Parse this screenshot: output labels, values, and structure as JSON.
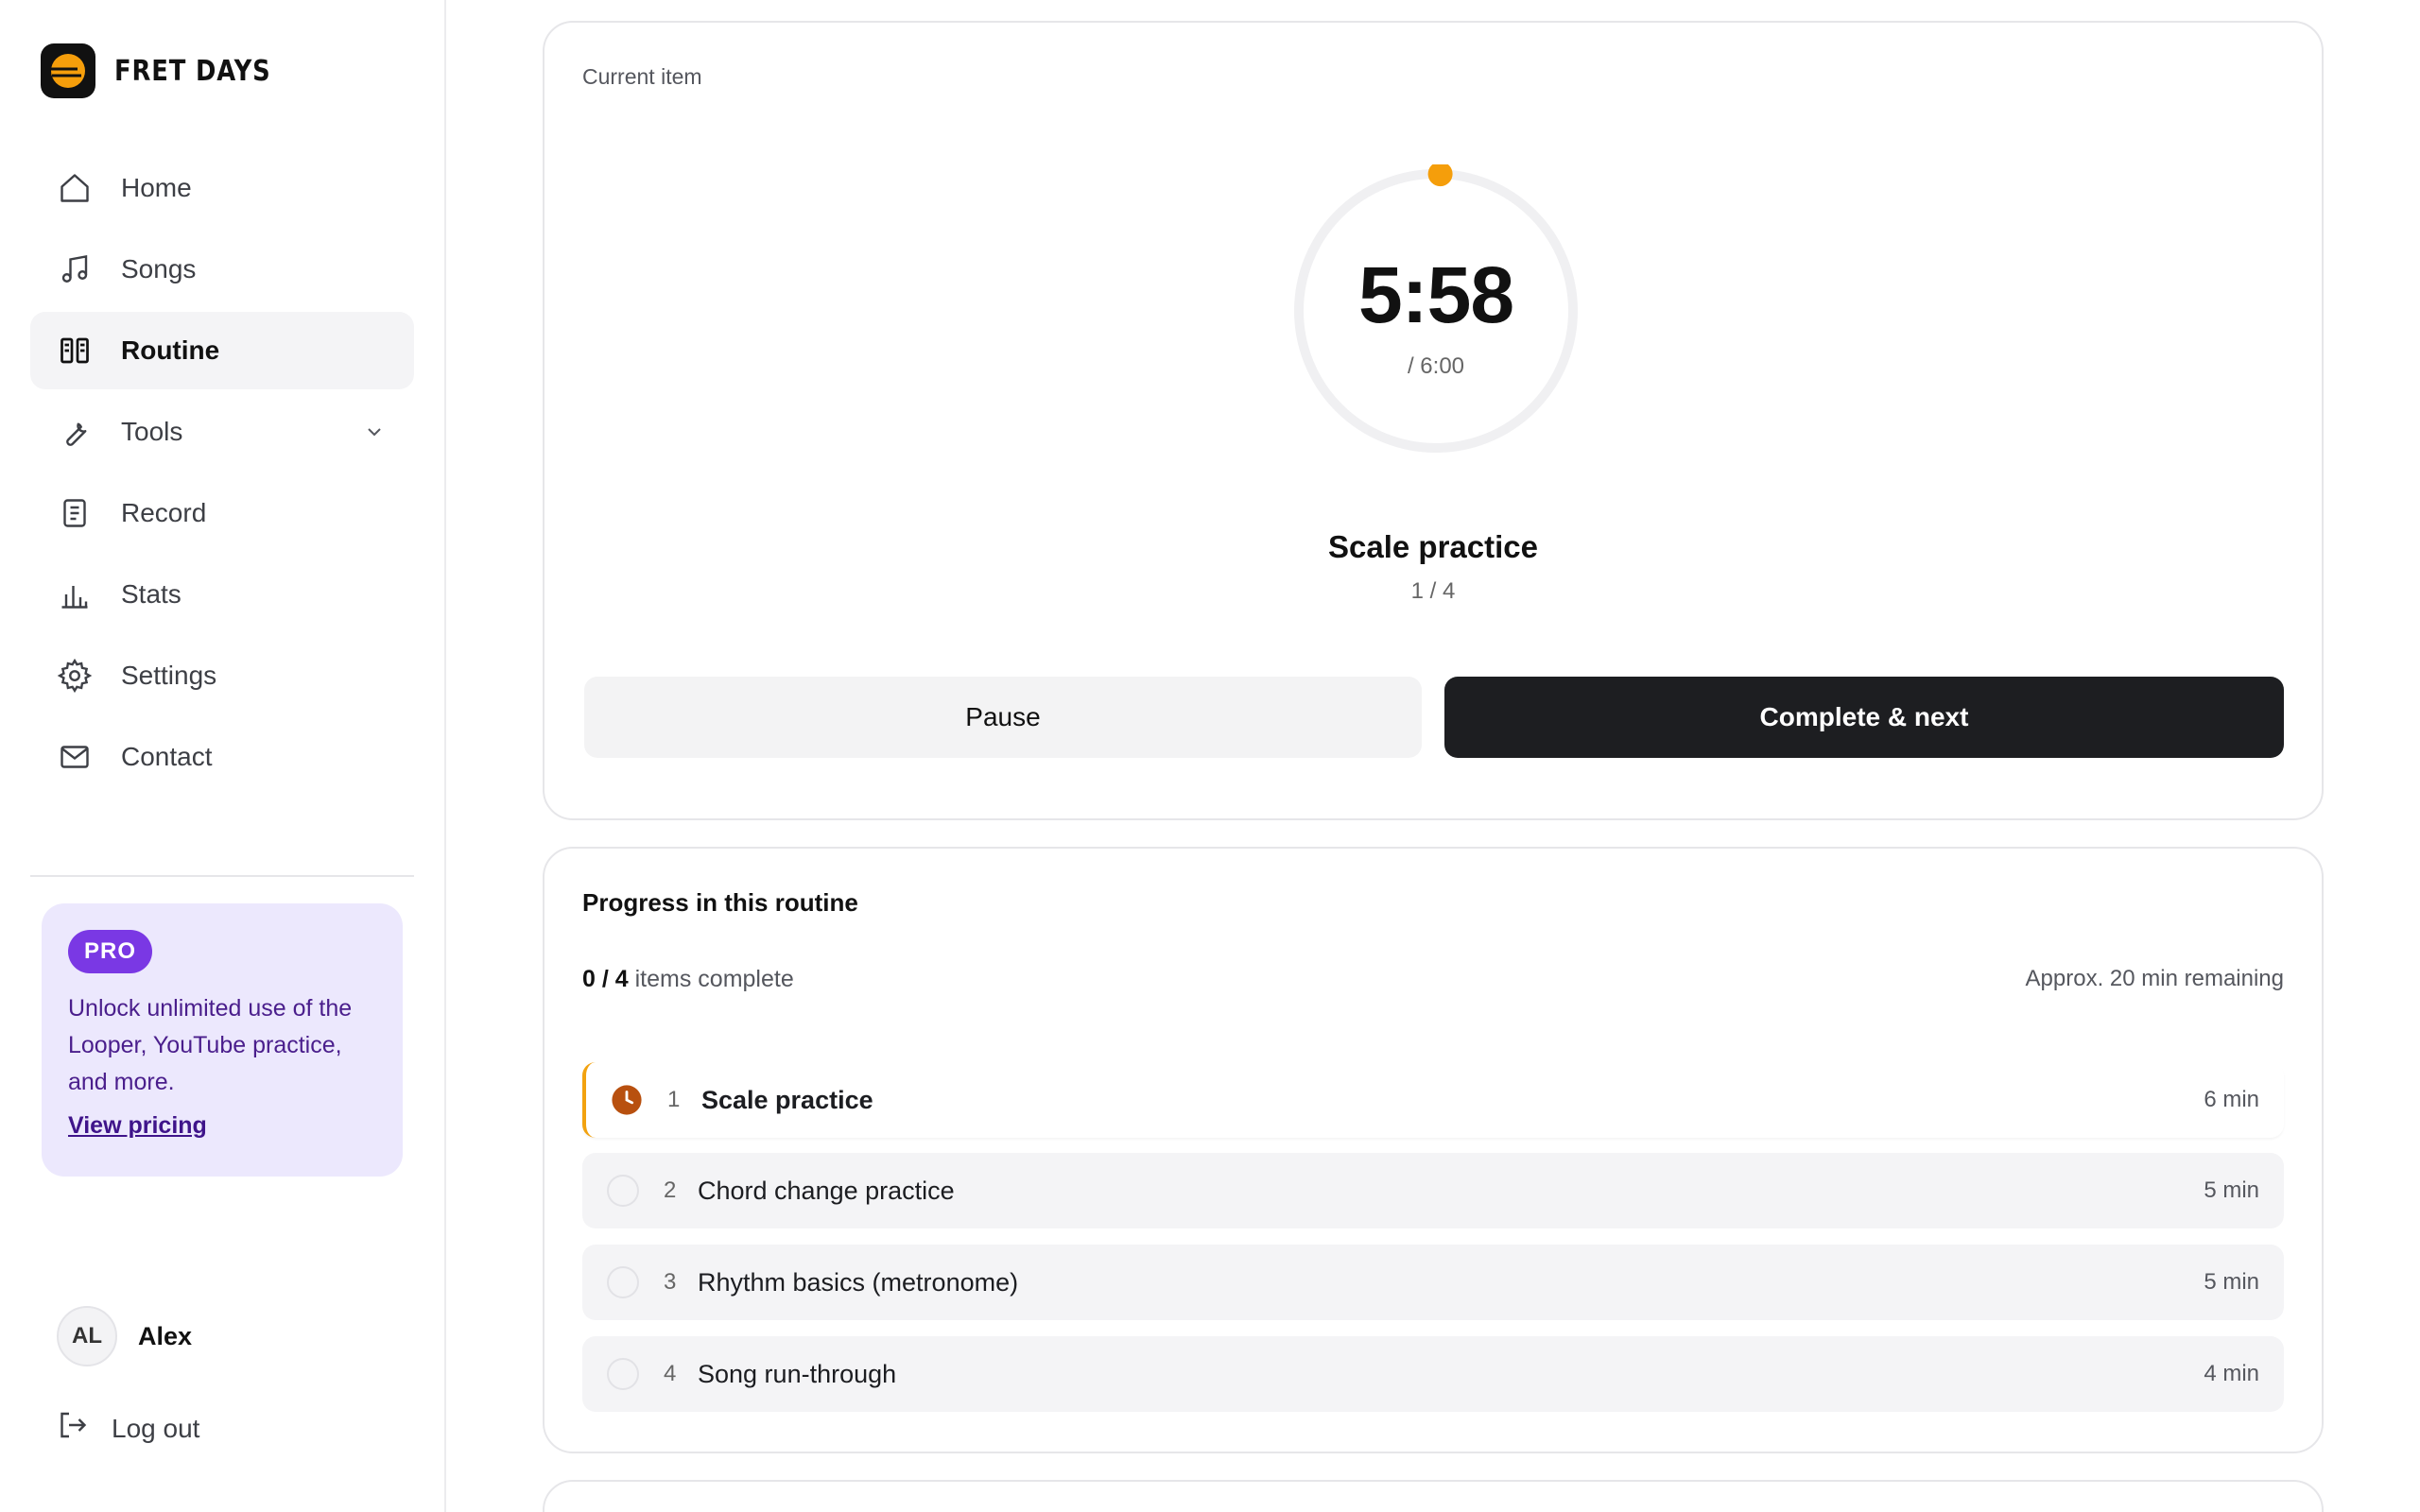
{
  "brand": {
    "name": "FRET DAYS"
  },
  "nav": {
    "items": [
      {
        "label": "Home",
        "icon": "home-icon"
      },
      {
        "label": "Songs",
        "icon": "music-note-icon"
      },
      {
        "label": "Routine",
        "icon": "routine-icon",
        "active": true
      },
      {
        "label": "Tools",
        "icon": "wrench-icon"
      },
      {
        "label": "Record",
        "icon": "clipboard-icon"
      },
      {
        "label": "Stats",
        "icon": "bar-chart-icon"
      },
      {
        "label": "Settings",
        "icon": "gear-icon"
      },
      {
        "label": "Contact",
        "icon": "mail-icon"
      }
    ]
  },
  "pro": {
    "badge": "PRO",
    "text": "Unlock unlimited use of the Looper, YouTube practice, and more.",
    "link": "View pricing"
  },
  "user": {
    "initials": "AL",
    "name": "Alex",
    "logout": "Log out"
  },
  "current": {
    "label": "Current item",
    "time": "5:58",
    "total": "/ 6:00",
    "elapsed_fraction": 0.005,
    "title": "Scale practice",
    "position": "1 / 4",
    "pause_label": "Pause",
    "next_label": "Complete & next"
  },
  "progress": {
    "title": "Progress in this routine",
    "done": "0 / 4",
    "done_suffix": "items complete",
    "remaining": "Approx. 20 min remaining",
    "items": [
      {
        "num": "1",
        "name": "Scale practice",
        "duration": "6 min",
        "status": "in-progress"
      },
      {
        "num": "2",
        "name": "Chord change practice",
        "duration": "5 min",
        "status": "pending"
      },
      {
        "num": "3",
        "name": "Rhythm basics (metronome)",
        "duration": "5 min",
        "status": "pending"
      },
      {
        "num": "4",
        "name": "Song run-through",
        "duration": "4 min",
        "status": "pending"
      }
    ]
  },
  "colors": {
    "accent": "#f59e0b",
    "pro": "#7a38e4",
    "dark": "#1d1e21"
  }
}
